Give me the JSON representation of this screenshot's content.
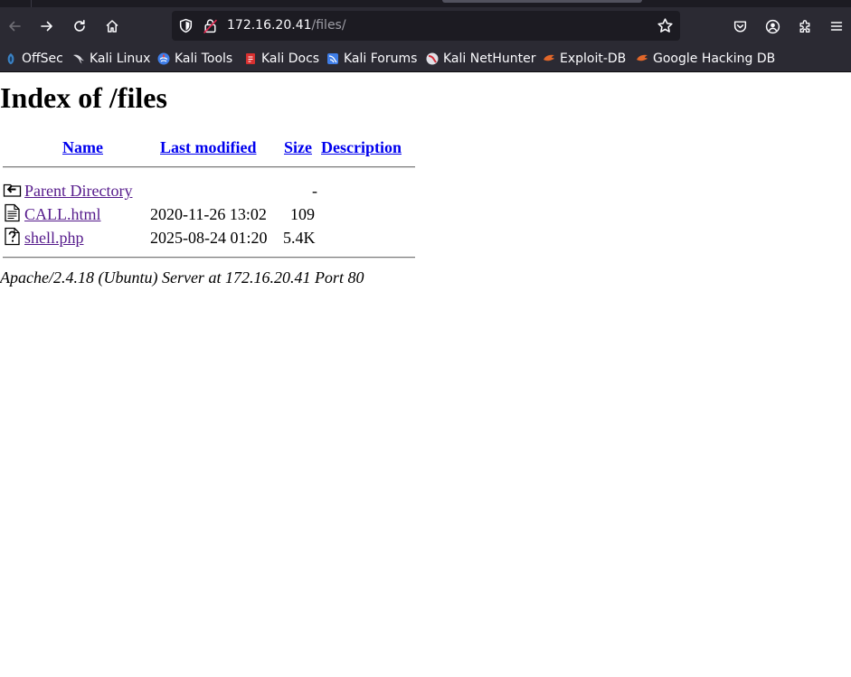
{
  "browser": {
    "url_host": "172.16.20.41",
    "url_path": "/files/",
    "bookmarks": [
      {
        "label": "OffSec",
        "icon": "offsec-icon"
      },
      {
        "label": "Kali Linux",
        "icon": "kali-dragon-icon"
      },
      {
        "label": "Kali Tools",
        "icon": "kali-tools-icon"
      },
      {
        "label": "Kali Docs",
        "icon": "kali-docs-icon"
      },
      {
        "label": "Kali Forums",
        "icon": "kali-forums-icon"
      },
      {
        "label": "Kali NetHunter",
        "icon": "kali-nethunter-icon"
      },
      {
        "label": "Exploit-DB",
        "icon": "exploit-db-icon"
      },
      {
        "label": "Google Hacking DB",
        "icon": "ghdb-icon"
      }
    ]
  },
  "page": {
    "title": "Index of /files",
    "columns": {
      "name": "Name",
      "last_modified": "Last modified",
      "size": "Size",
      "description": "Description"
    },
    "rows": [
      {
        "name": "Parent Directory",
        "modified": "",
        "size": "-",
        "icon": "back-folder-icon"
      },
      {
        "name": "CALL.html",
        "modified": "2020-11-26 13:02",
        "size": "109",
        "icon": "text-file-icon"
      },
      {
        "name": "shell.php",
        "modified": "2025-08-24 01:20",
        "size": "5.4K",
        "icon": "unknown-file-icon"
      }
    ],
    "footer": "Apache/2.4.18 (Ubuntu) Server at 172.16.20.41 Port 80"
  },
  "colors": {
    "chrome_bg": "#2b2a33",
    "urlbar_bg": "#1c1b22",
    "link": "#0000ee",
    "visited_link": "#551a8b"
  }
}
